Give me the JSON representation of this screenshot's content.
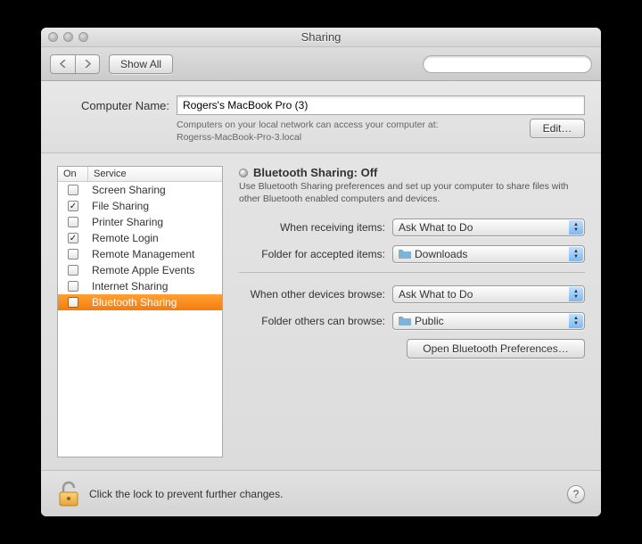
{
  "window": {
    "title": "Sharing"
  },
  "toolbar": {
    "show_all": "Show All",
    "search_placeholder": ""
  },
  "computer_name": {
    "label": "Computer Name:",
    "value": "Rogers's MacBook Pro (3)",
    "desc_line1": "Computers on your local network can access your computer at:",
    "desc_line2": "Rogerss-MacBook-Pro-3.local",
    "edit": "Edit…"
  },
  "list": {
    "header_on": "On",
    "header_service": "Service",
    "items": [
      {
        "on": false,
        "name": "Screen Sharing",
        "selected": false
      },
      {
        "on": true,
        "name": "File Sharing",
        "selected": false
      },
      {
        "on": false,
        "name": "Printer Sharing",
        "selected": false
      },
      {
        "on": true,
        "name": "Remote Login",
        "selected": false
      },
      {
        "on": false,
        "name": "Remote Management",
        "selected": false
      },
      {
        "on": false,
        "name": "Remote Apple Events",
        "selected": false
      },
      {
        "on": false,
        "name": "Internet Sharing",
        "selected": false
      },
      {
        "on": false,
        "name": "Bluetooth Sharing",
        "selected": true
      }
    ]
  },
  "detail": {
    "title": "Bluetooth Sharing: Off",
    "desc": "Use Bluetooth Sharing preferences and set up your computer to share files with other Bluetooth enabled computers and devices.",
    "opt1_label": "When receiving items:",
    "opt1_value": "Ask What to Do",
    "opt2_label": "Folder for accepted items:",
    "opt2_value": "Downloads",
    "opt3_label": "When other devices browse:",
    "opt3_value": "Ask What to Do",
    "opt4_label": "Folder others can browse:",
    "opt4_value": "Public",
    "open_bt": "Open Bluetooth Preferences…"
  },
  "footer": {
    "text": "Click the lock to prevent further changes.",
    "help": "?"
  }
}
